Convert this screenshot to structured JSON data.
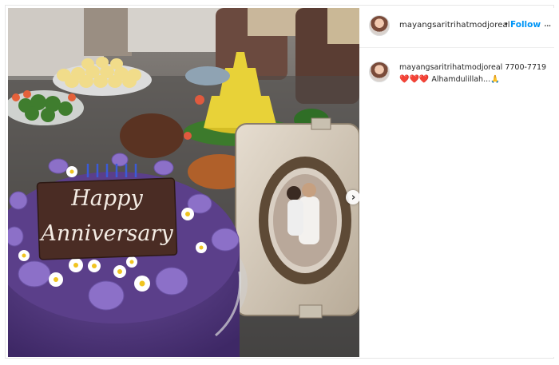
{
  "post": {
    "username": "mayangsaritrihatmodjoreal",
    "separator": "•",
    "follow_label": "Follow",
    "more_icon": "...",
    "caption": {
      "username": "mayangsaritrihatmodjoreal",
      "text": "7700-7719",
      "hearts": "❤️❤️❤️",
      "message": "Alhamdulillah...🙏"
    },
    "photo": {
      "cake_topper_line1": "Happy",
      "cake_topper_line2": "Anniversary"
    },
    "next_icon": "›"
  },
  "colors": {
    "follow": "#0095f6",
    "text": "#262626",
    "cake_purple": "#5b3f8a",
    "macaron": "#8c70c8",
    "tumpeng": "#e8d238"
  }
}
